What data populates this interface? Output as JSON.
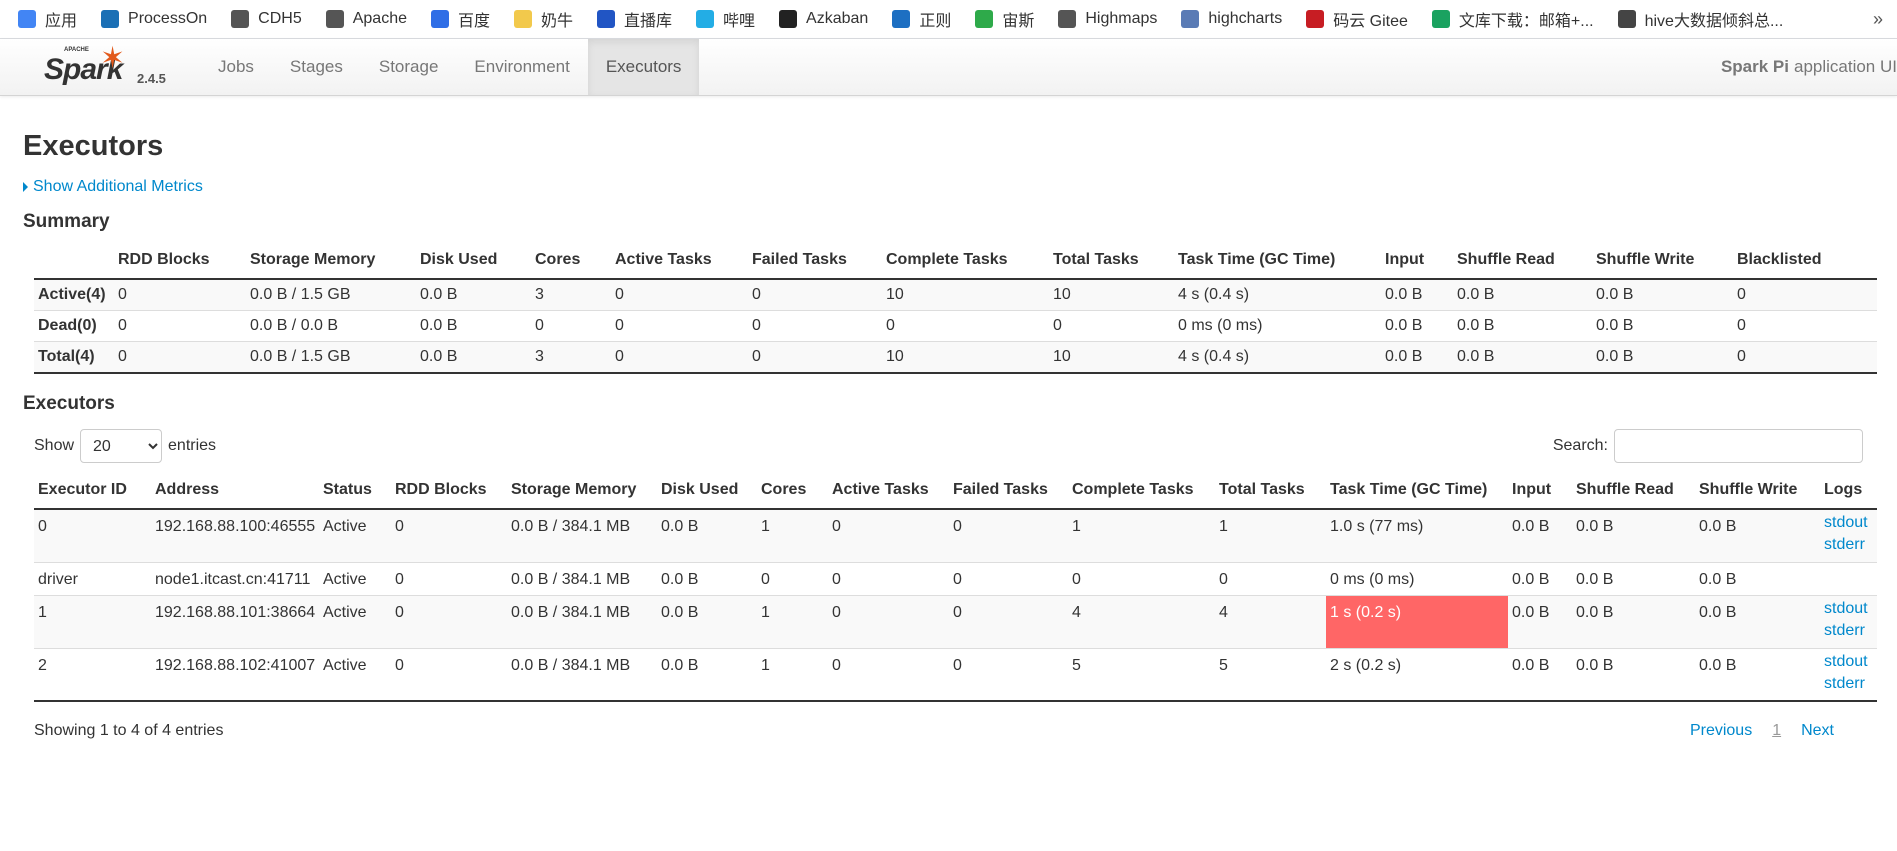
{
  "bookmarks": [
    {
      "label": "应用",
      "icon": "apps-grid-icon",
      "color": "#4285f4"
    },
    {
      "label": "ProcessOn",
      "icon": "processon-icon",
      "color": "#1a6fb5"
    },
    {
      "label": "CDH5",
      "icon": "globe-icon",
      "color": "#555"
    },
    {
      "label": "Apache",
      "icon": "globe-icon",
      "color": "#555"
    },
    {
      "label": "百度",
      "icon": "baidu-paw-icon",
      "color": "#2f6ee6"
    },
    {
      "label": "奶牛",
      "icon": "cow-icon",
      "color": "#f2c94c"
    },
    {
      "label": "直播库",
      "icon": "live-icon",
      "color": "#2155c4"
    },
    {
      "label": "哔哩",
      "icon": "bilibili-icon",
      "color": "#23ade5"
    },
    {
      "label": "Azkaban",
      "icon": "azkaban-icon",
      "color": "#222"
    },
    {
      "label": "正则",
      "icon": "regex-icon",
      "color": "#1d6fc2"
    },
    {
      "label": "宙斯",
      "icon": "zeus-icon",
      "color": "#2eaa4a"
    },
    {
      "label": "Highmaps",
      "icon": "globe-icon",
      "color": "#555"
    },
    {
      "label": "highcharts",
      "icon": "highcharts-icon",
      "color": "#5a7bb5"
    },
    {
      "label": "码云 Gitee",
      "icon": "gitee-icon",
      "color": "#c71d23"
    },
    {
      "label": "文库下载：邮箱+...",
      "icon": "wenku-icon",
      "color": "#1aa260"
    },
    {
      "label": "hive大数据倾斜总...",
      "icon": "hive-icon",
      "color": "#444"
    }
  ],
  "bookmarks_more": "»",
  "nav": {
    "logo_word": "Spark",
    "logo_apache": "APACHE",
    "version": "2.4.5",
    "tabs": [
      {
        "label": "Jobs"
      },
      {
        "label": "Stages"
      },
      {
        "label": "Storage"
      },
      {
        "label": "Environment"
      },
      {
        "label": "Executors",
        "active": true
      }
    ],
    "app_name": "Spark Pi",
    "app_suffix": "application UI"
  },
  "page": {
    "title": "Executors",
    "additional_metrics": "Show Additional Metrics",
    "summary_title": "Summary",
    "executors_title": "Executors"
  },
  "summary": {
    "headers": [
      "",
      "RDD Blocks",
      "Storage Memory",
      "Disk Used",
      "Cores",
      "Active Tasks",
      "Failed Tasks",
      "Complete Tasks",
      "Total Tasks",
      "Task Time (GC Time)",
      "Input",
      "Shuffle Read",
      "Shuffle Write",
      "Blacklisted"
    ],
    "rows": [
      [
        "Active(4)",
        "0",
        "0.0 B / 1.5 GB",
        "0.0 B",
        "3",
        "0",
        "0",
        "10",
        "10",
        "4 s (0.4 s)",
        "0.0 B",
        "0.0 B",
        "0.0 B",
        "0"
      ],
      [
        "Dead(0)",
        "0",
        "0.0 B / 0.0 B",
        "0.0 B",
        "0",
        "0",
        "0",
        "0",
        "0",
        "0 ms (0 ms)",
        "0.0 B",
        "0.0 B",
        "0.0 B",
        "0"
      ],
      [
        "Total(4)",
        "0",
        "0.0 B / 1.5 GB",
        "0.0 B",
        "3",
        "0",
        "0",
        "10",
        "10",
        "4 s (0.4 s)",
        "0.0 B",
        "0.0 B",
        "0.0 B",
        "0"
      ]
    ]
  },
  "executors": {
    "show_label": "Show",
    "entries_label": "entries",
    "page_size": "20",
    "search_label": "Search:",
    "search_value": "",
    "headers": [
      "Executor ID",
      "Address",
      "Status",
      "RDD Blocks",
      "Storage Memory",
      "Disk Used",
      "Cores",
      "Active Tasks",
      "Failed Tasks",
      "Complete Tasks",
      "Total Tasks",
      "Task Time (GC Time)",
      "Input",
      "Shuffle Read",
      "Shuffle Write",
      "Logs"
    ],
    "rows": [
      {
        "cells": [
          "0",
          "192.168.88.100:46555",
          "Active",
          "0",
          "0.0 B / 384.1 MB",
          "0.0 B",
          "1",
          "0",
          "0",
          "1",
          "1",
          "1.0 s (77 ms)",
          "0.0 B",
          "0.0 B",
          "0.0 B"
        ],
        "logs": [
          "stdout",
          "stderr"
        ],
        "highlight": false
      },
      {
        "cells": [
          "driver",
          "node1.itcast.cn:41711",
          "Active",
          "0",
          "0.0 B / 384.1 MB",
          "0.0 B",
          "0",
          "0",
          "0",
          "0",
          "0",
          "0 ms (0 ms)",
          "0.0 B",
          "0.0 B",
          "0.0 B"
        ],
        "logs": [],
        "highlight": false
      },
      {
        "cells": [
          "1",
          "192.168.88.101:38664",
          "Active",
          "0",
          "0.0 B / 384.1 MB",
          "0.0 B",
          "1",
          "0",
          "0",
          "4",
          "4",
          "1 s (0.2 s)",
          "0.0 B",
          "0.0 B",
          "0.0 B"
        ],
        "logs": [
          "stdout",
          "stderr"
        ],
        "highlight": true
      },
      {
        "cells": [
          "2",
          "192.168.88.102:41007",
          "Active",
          "0",
          "0.0 B / 384.1 MB",
          "0.0 B",
          "1",
          "0",
          "0",
          "5",
          "5",
          "2 s (0.2 s)",
          "0.0 B",
          "0.0 B",
          "0.0 B"
        ],
        "logs": [
          "stdout",
          "stderr"
        ],
        "highlight": false
      }
    ],
    "highlight_color": "#ff6666",
    "info": "Showing 1 to 4 of 4 entries",
    "pagination": {
      "previous": "Previous",
      "current": "1",
      "next": "Next"
    }
  }
}
